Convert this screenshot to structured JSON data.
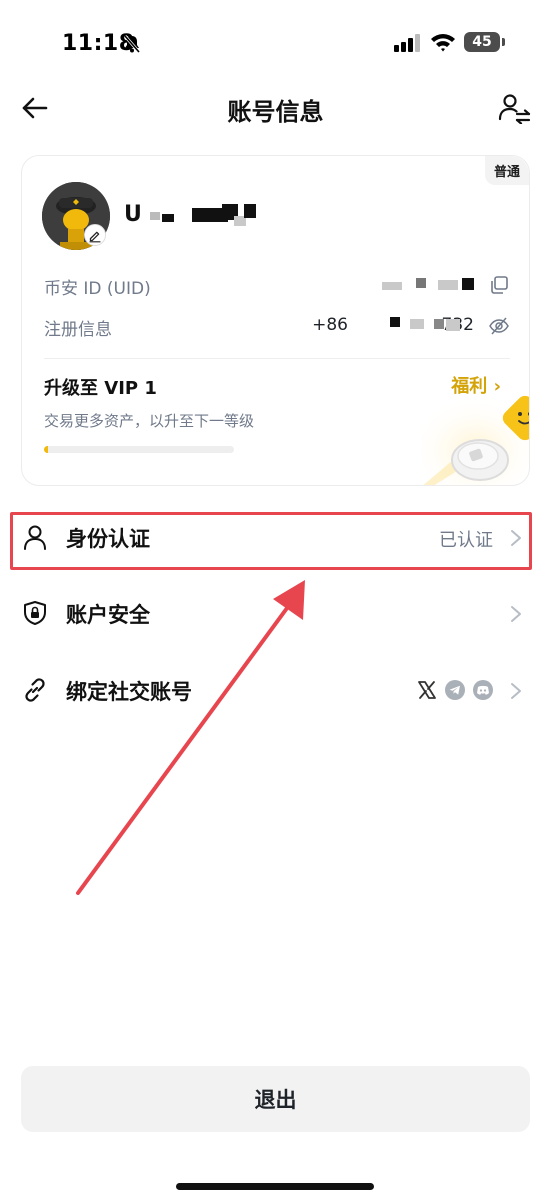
{
  "status_bar": {
    "time": "11:18",
    "battery": "45"
  },
  "header": {
    "title": "账号信息"
  },
  "profile": {
    "badge": "普通",
    "username": "U",
    "uid_label": "币安 ID (UID)",
    "uid_value": "",
    "register_label": "注册信息",
    "register_value": "+86",
    "register_value_end": "732"
  },
  "vip": {
    "title": "升级至 VIP 1",
    "link_label": "福利",
    "subtitle": "交易更多资产，以升至下一等级",
    "progress": 0.02
  },
  "menu": {
    "identity": {
      "label": "身份认证",
      "status": "已认证"
    },
    "security": {
      "label": "账户安全"
    },
    "social": {
      "label": "绑定社交账号"
    }
  },
  "footer": {
    "logout_label": "退出"
  },
  "colors": {
    "accent": "#F0B90B",
    "link": "#D4A308",
    "annotation": "#E8464F"
  },
  "icons": [
    "bell-off-icon",
    "signal-icon",
    "wifi-icon",
    "back-arrow-icon",
    "switch-account-icon",
    "edit-icon",
    "copy-icon",
    "eye-off-icon",
    "person-icon",
    "shield-lock-icon",
    "link-icon",
    "x-icon",
    "telegram-icon",
    "discord-icon",
    "chevron-right-icon"
  ]
}
